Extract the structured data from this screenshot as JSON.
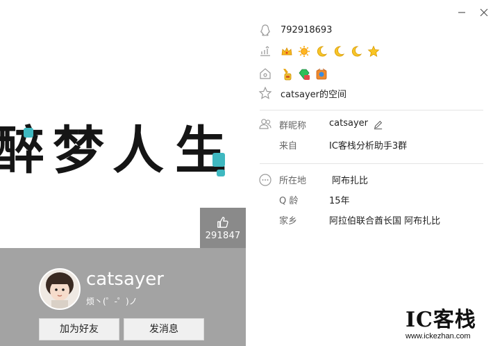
{
  "cover": {
    "chars": [
      "醉",
      "梦",
      "人",
      "生"
    ]
  },
  "likes": {
    "count": "291847"
  },
  "profile": {
    "nickname": "catsayer",
    "signature": "烦丶(゜-゜)ノ",
    "add_friend_label": "加为好友",
    "send_message_label": "发消息"
  },
  "info": {
    "qq_number": "792918693",
    "qzone_label": "catsayer的空间"
  },
  "group": {
    "nickname_label": "群昵称",
    "nickname_value": "catsayer",
    "from_label": "来自",
    "from_value": "IC客栈分析助手3群"
  },
  "details": {
    "location_label": "所在地",
    "location_value": "阿布扎比",
    "age_label": "Q 龄",
    "age_value": "15年",
    "hometown_label": "家乡",
    "hometown_value": "阿拉伯联合酋长国 阿布扎比"
  },
  "watermark": {
    "brand": "IC客栈",
    "url": "www.ickezhan.com"
  },
  "colors": {
    "profile_bar": "#a3a3a3",
    "like_box": "#8a8a8a",
    "accent": "#3fb8c0"
  }
}
